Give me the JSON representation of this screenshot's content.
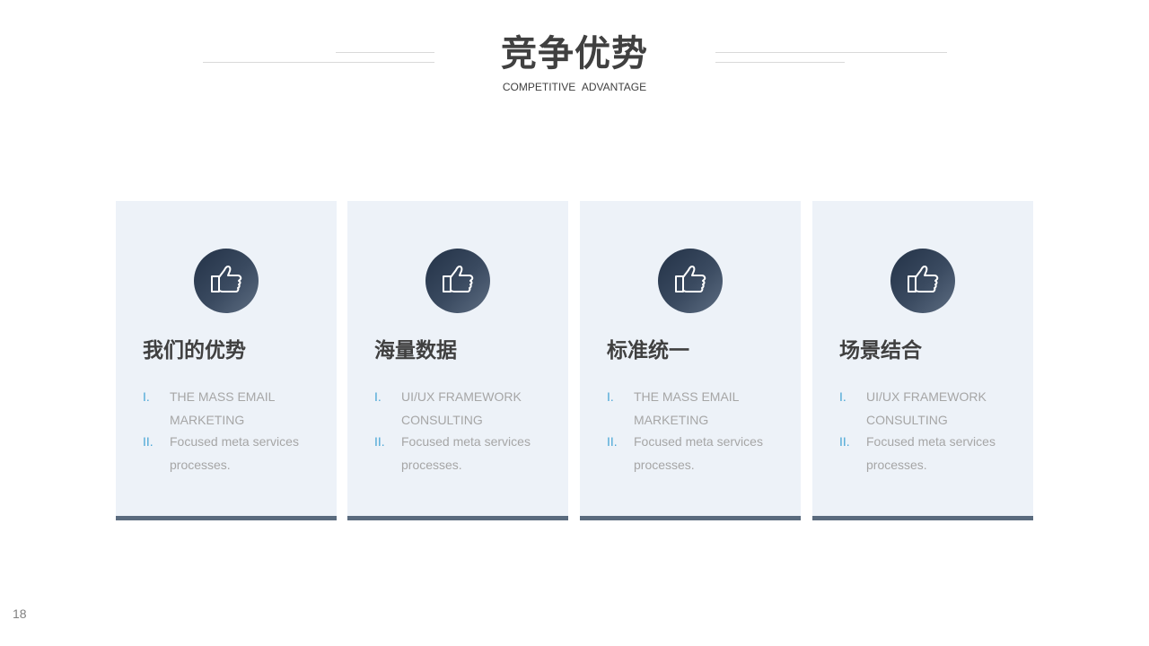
{
  "header": {
    "title": "竞争优势",
    "subtitle": "COMPETITIVE  ADVANTAGE"
  },
  "cards": [
    {
      "title": "我们的优势",
      "icon": "thumbs-up-icon",
      "items": [
        {
          "num": "I.",
          "text": "THE MASS EMAIL MARKETING"
        },
        {
          "num": "II.",
          "text": "Focused meta services processes."
        }
      ]
    },
    {
      "title": "海量数据",
      "icon": "thumbs-up-icon",
      "items": [
        {
          "num": "I.",
          "text": "UI/UX  FRAMEWORK CONSULTING"
        },
        {
          "num": "II.",
          "text": "Focused meta services processes."
        }
      ]
    },
    {
      "title": "标准统一",
      "icon": "thumbs-up-icon",
      "items": [
        {
          "num": "I.",
          "text": "THE MASS EMAIL MARKETING"
        },
        {
          "num": "II.",
          "text": "Focused meta services processes."
        }
      ]
    },
    {
      "title": "场景结合",
      "icon": "thumbs-up-icon",
      "items": [
        {
          "num": "I.",
          "text": "UI/UX  FRAMEWORK CONSULTING"
        },
        {
          "num": "II.",
          "text": "Focused meta services processes."
        }
      ]
    }
  ],
  "page_number": "18",
  "colors": {
    "card_background": "#edf2f8",
    "card_bottom_bar": "#5a6b7e",
    "icon_circle": "#2f3e53",
    "numeral_accent": "#4aa6d6",
    "title_text": "#404040",
    "body_text": "#a6a6a6"
  }
}
